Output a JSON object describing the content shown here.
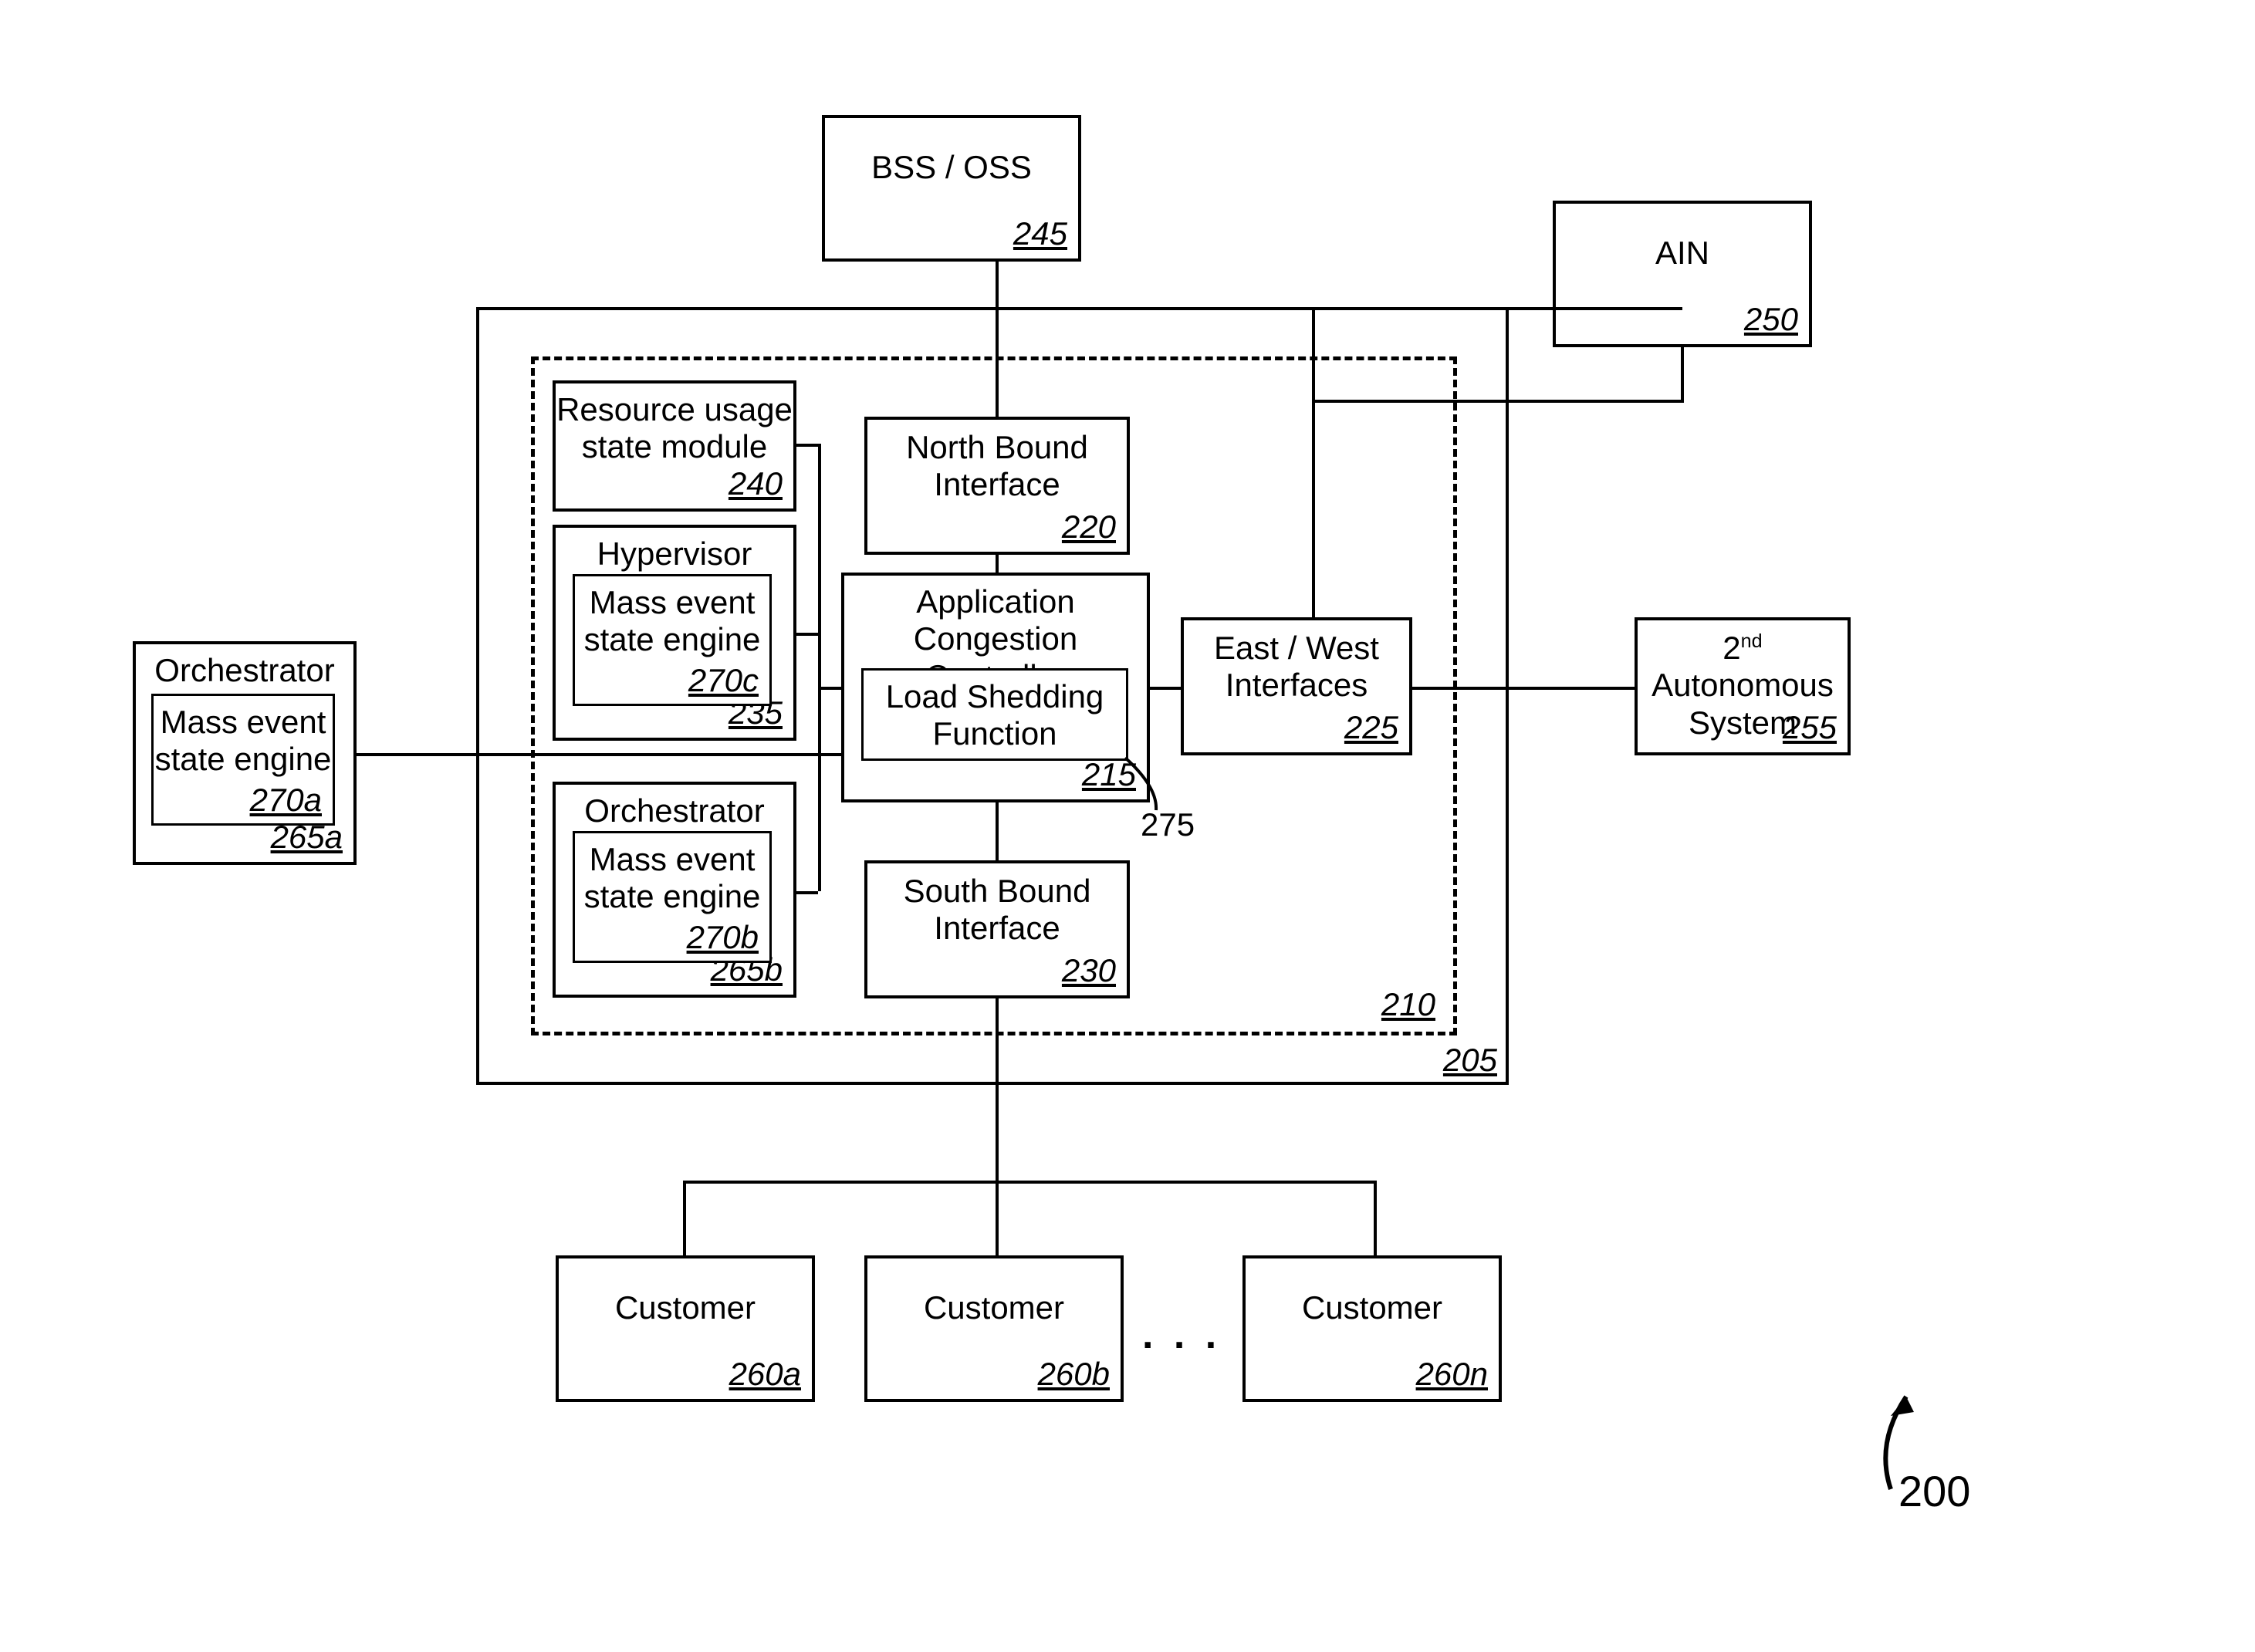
{
  "figure_ref": "200",
  "boxes": {
    "bss": {
      "label": "BSS / OSS",
      "ref": "245"
    },
    "ain": {
      "label": "AIN",
      "ref": "250"
    },
    "outer": {
      "ref": "205"
    },
    "inner": {
      "ref": "210"
    },
    "orch_ext": {
      "label": "Orchestrator",
      "ref": "265a",
      "child": {
        "label": "Mass event state engine",
        "ref": "270a"
      }
    },
    "rusage": {
      "label": "Resource usage state module",
      "ref": "240"
    },
    "hyp": {
      "label": "Hypervisor",
      "ref": "235",
      "child": {
        "label": "Mass event state engine",
        "ref": "270c"
      }
    },
    "orch_int": {
      "label": "Orchestrator",
      "ref": "265b",
      "child": {
        "label": "Mass event state engine",
        "ref": "270b"
      }
    },
    "nbi": {
      "label": "North Bound Interface",
      "ref": "220"
    },
    "acc": {
      "label": "Application Congestion Controller",
      "ref": "215",
      "child": {
        "label": "Load Shedding Function",
        "ref_external": "275"
      }
    },
    "sbi": {
      "label": "South Bound Interface",
      "ref": "230"
    },
    "ewi": {
      "label": "East / West Interfaces",
      "ref": "225"
    },
    "as2": {
      "label_html": "2<sup>nd</sup> Autonomous System",
      "ref": "255"
    },
    "cust_a": {
      "label": "Customer",
      "ref": "260a"
    },
    "cust_b": {
      "label": "Customer",
      "ref": "260b"
    },
    "cust_n": {
      "label": "Customer",
      "ref": "260n"
    }
  },
  "ellipsis": ". . ."
}
